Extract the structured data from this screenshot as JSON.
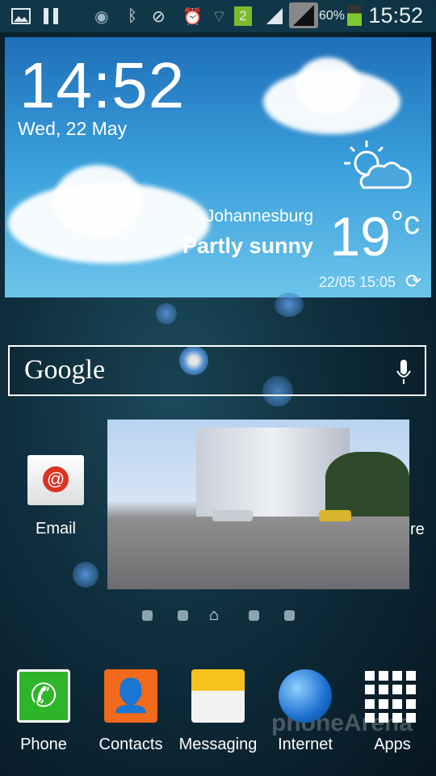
{
  "status_bar": {
    "battery": "60%",
    "time": "15:52",
    "sim_slot": "2",
    "icons": [
      "gallery-icon",
      "pause-icon",
      "eye-icon",
      "bluetooth-icon",
      "mute-icon",
      "alarm-icon",
      "wifi-icon",
      "sim-2-icon",
      "signal-icon",
      "signal-icon-2",
      "battery-icon"
    ]
  },
  "weather": {
    "time": "14:52",
    "date": "Wed, 22 May",
    "city": "Johannesburg",
    "condition": "Partly sunny",
    "temperature": "19",
    "unit": "°c",
    "updated": "22/05 15:05",
    "icon": "partly-sunny-icon"
  },
  "search": {
    "logo": "Google",
    "mic_icon": "mic-icon"
  },
  "home": {
    "email_label": "Email",
    "partial_label": "re",
    "pages": 5,
    "current_page": 3
  },
  "dock": [
    {
      "label": "Phone"
    },
    {
      "label": "Contacts"
    },
    {
      "label": "Messaging"
    },
    {
      "label": "Internet"
    },
    {
      "label": "Apps"
    }
  ],
  "watermark": "phoneArena"
}
